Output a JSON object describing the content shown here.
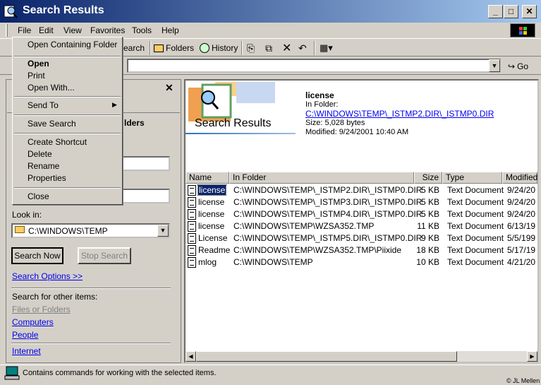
{
  "window": {
    "title": "Search Results"
  },
  "menubar": [
    "File",
    "Edit",
    "View",
    "Favorites",
    "Tools",
    "Help"
  ],
  "toolbar": {
    "search": "Search",
    "folders": "Folders",
    "history": "History"
  },
  "address": {
    "go": "Go"
  },
  "file_menu": {
    "items": [
      "Open Containing Folder",
      "Open",
      "Print",
      "Open With...",
      "Send To",
      "Save Search",
      "Create Shortcut",
      "Delete",
      "Rename",
      "Properties",
      "Close"
    ]
  },
  "left_pane": {
    "partial_label": "lders",
    "look_in_label": "Look in:",
    "look_in_value": "C:\\WINDOWS\\TEMP",
    "search_now": "Search Now",
    "stop_search": "Stop Search",
    "search_options": "Search Options >>",
    "other_items_label": "Search for other items:",
    "files_or_folders": "Files or Folders",
    "computers": "Computers",
    "people": "People",
    "internet": "Internet"
  },
  "details": {
    "banner_title": "Search Results",
    "name": "license",
    "in_folder_label": "In Folder:",
    "in_folder_value": "C:\\WINDOWS\\TEMP\\_ISTMP2.DIR\\_ISTMP0.DIR",
    "size": "Size: 5,028 bytes",
    "modified": "Modified: 9/24/2001 10:40 AM"
  },
  "columns": [
    "Name",
    "In Folder",
    "Size",
    "Type",
    "Modified"
  ],
  "rows": [
    {
      "name": "license",
      "folder": "C:\\WINDOWS\\TEMP\\_ISTMP2.DIR\\_ISTMP0.DIR",
      "size": "5 KB",
      "type": "Text Document",
      "modified": "9/24/20"
    },
    {
      "name": "license",
      "folder": "C:\\WINDOWS\\TEMP\\_ISTMP3.DIR\\_ISTMP0.DIR",
      "size": "5 KB",
      "type": "Text Document",
      "modified": "9/24/20"
    },
    {
      "name": "license",
      "folder": "C:\\WINDOWS\\TEMP\\_ISTMP4.DIR\\_ISTMP0.DIR",
      "size": "5 KB",
      "type": "Text Document",
      "modified": "9/24/20"
    },
    {
      "name": "license",
      "folder": "C:\\WINDOWS\\TEMP\\WZSA352.TMP",
      "size": "11 KB",
      "type": "Text Document",
      "modified": "6/13/19"
    },
    {
      "name": "License",
      "folder": "C:\\WINDOWS\\TEMP\\_ISTMP5.DIR\\_ISTMP0.DIR",
      "size": "9 KB",
      "type": "Text Document",
      "modified": "5/5/199"
    },
    {
      "name": "Readme",
      "folder": "C:\\WINDOWS\\TEMP\\WZSA352.TMP\\Piixide",
      "size": "18 KB",
      "type": "Text Document",
      "modified": "5/17/19"
    },
    {
      "name": "mlog",
      "folder": "C:\\WINDOWS\\TEMP",
      "size": "10 KB",
      "type": "Text Document",
      "modified": "4/21/20"
    }
  ],
  "status": {
    "text": "Contains commands for working with the selected items.",
    "credit": "© JL Mellen"
  }
}
